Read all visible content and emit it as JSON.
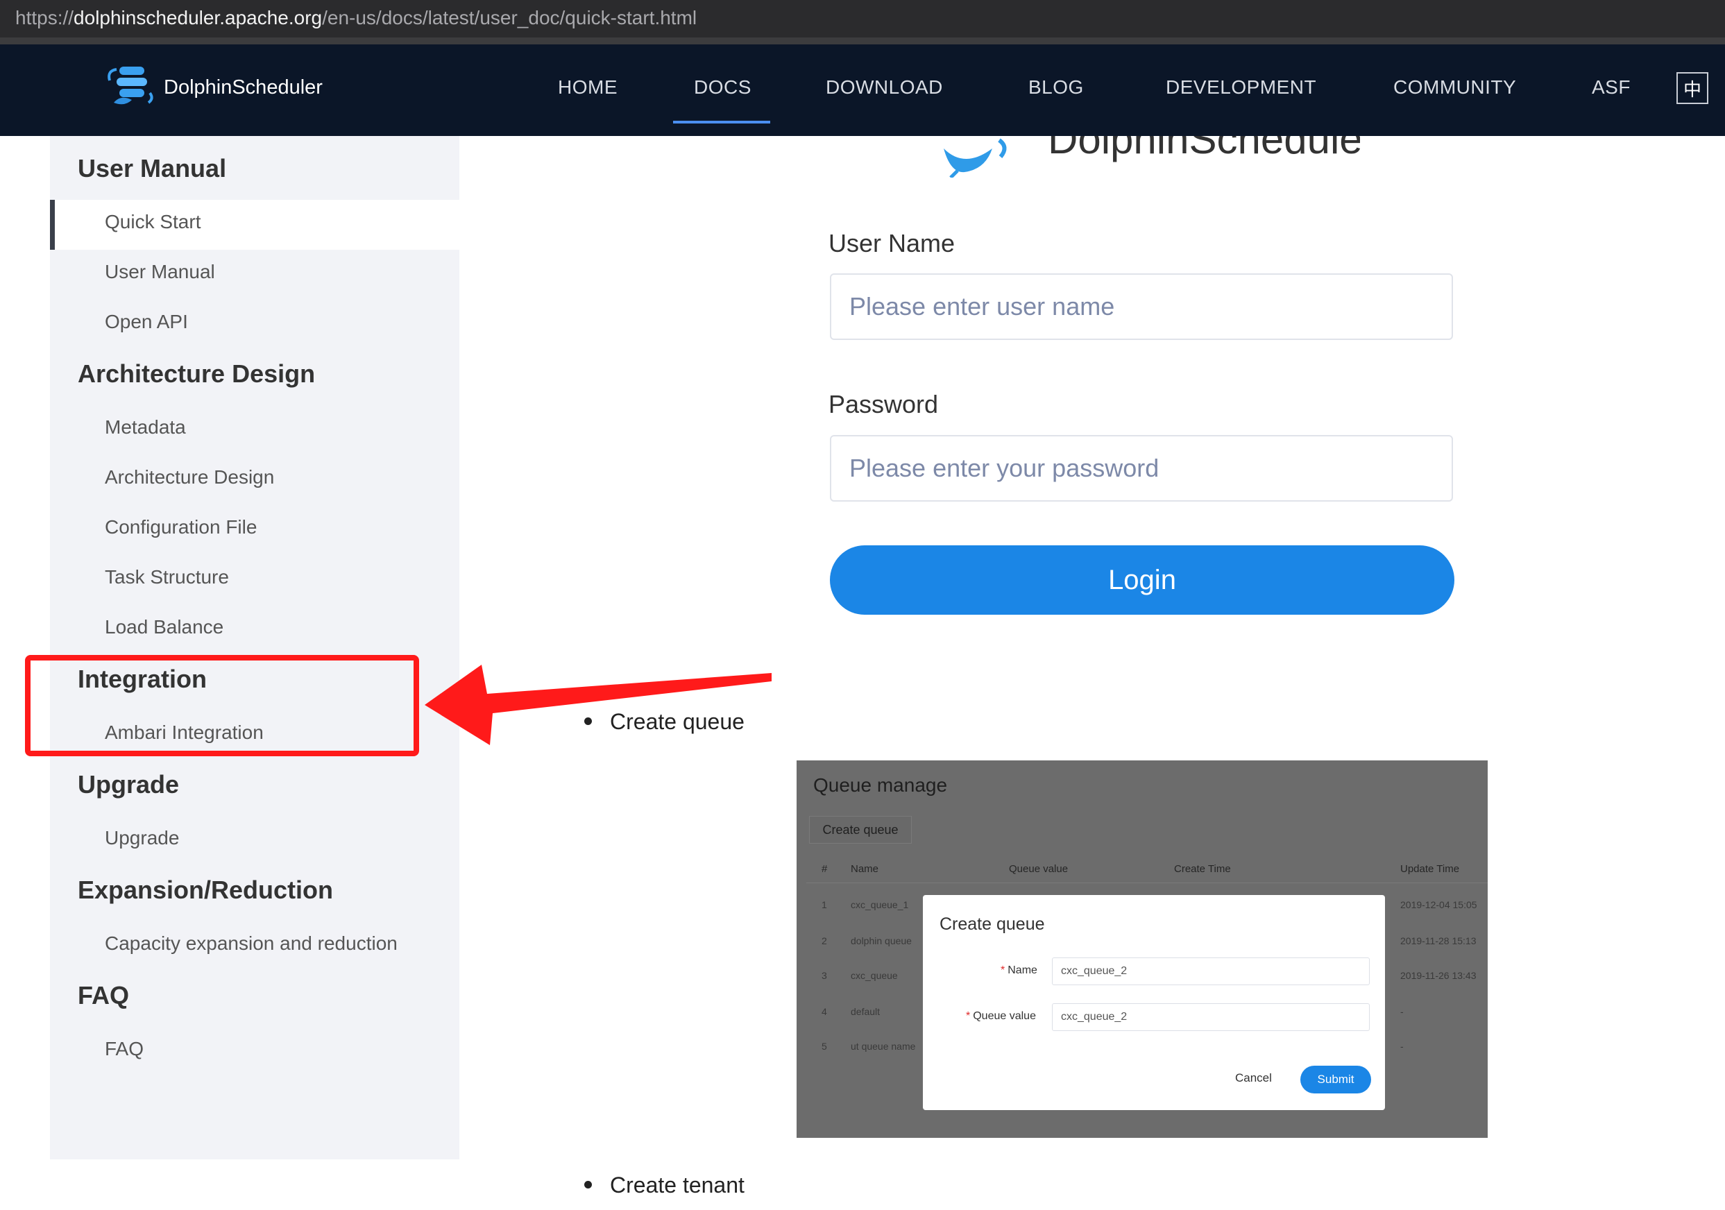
{
  "browser": {
    "url_scheme": "https://",
    "url_host": "dolphinscheduler.apache.org",
    "url_path": "/en-us/docs/latest/user_doc/quick-start.html"
  },
  "header": {
    "brand": "DolphinScheduler",
    "nav": [
      "HOME",
      "DOCS",
      "DOWNLOAD",
      "BLOG",
      "DEVELOPMENT",
      "COMMUNITY",
      "ASF"
    ],
    "active_nav": "DOCS",
    "lang_button": "中"
  },
  "sidebar": {
    "sections": [
      {
        "title": "User Manual",
        "items": [
          "Quick Start",
          "User Manual",
          "Open API"
        ]
      },
      {
        "title": "Architecture Design",
        "items": [
          "Metadata",
          "Architecture Design",
          "Configuration File",
          "Task Structure",
          "Load Balance"
        ]
      },
      {
        "title": "Integration",
        "items": [
          "Ambari Integration"
        ]
      },
      {
        "title": "Upgrade",
        "items": [
          "Upgrade"
        ]
      },
      {
        "title": "Expansion/Reduction",
        "items": [
          "Capacity expansion and reduction"
        ]
      },
      {
        "title": "FAQ",
        "items": [
          "FAQ"
        ]
      }
    ],
    "active_item": "Quick Start"
  },
  "login": {
    "logo_text": "DolphinScheduler",
    "username_label": "User Name",
    "username_placeholder": "Please enter user name",
    "password_label": "Password",
    "password_placeholder": "Please enter your password",
    "login_button": "Login"
  },
  "content": {
    "bullet_1": "Create queue",
    "bullet_2": "Create tenant"
  },
  "queue_screenshot": {
    "title": "Queue manage",
    "create_button": "Create queue",
    "columns": [
      "#",
      "Name",
      "Queue value",
      "Create Time",
      "Update Time"
    ],
    "rows": [
      {
        "num": "1",
        "name": "cxc_queue_1",
        "update": "2019-12-04 15:05"
      },
      {
        "num": "2",
        "name": "dolphin queue",
        "update": "2019-11-28 15:13"
      },
      {
        "num": "3",
        "name": "cxc_queue",
        "update": "2019-11-26 13:43"
      },
      {
        "num": "4",
        "name": "default",
        "update": "-"
      },
      {
        "num": "5",
        "name": "ut queue name",
        "update": "-"
      }
    ],
    "modal": {
      "title": "Create queue",
      "required_mark": "*",
      "name_label": "Name",
      "name_value": "cxc_queue_2",
      "queue_value_label": "Queue value",
      "queue_value_value": "cxc_queue_2",
      "cancel": "Cancel",
      "submit": "Submit"
    }
  },
  "annotation": {
    "box_color": "#ff1a1a",
    "arrow_color": "#ff1a1a"
  }
}
